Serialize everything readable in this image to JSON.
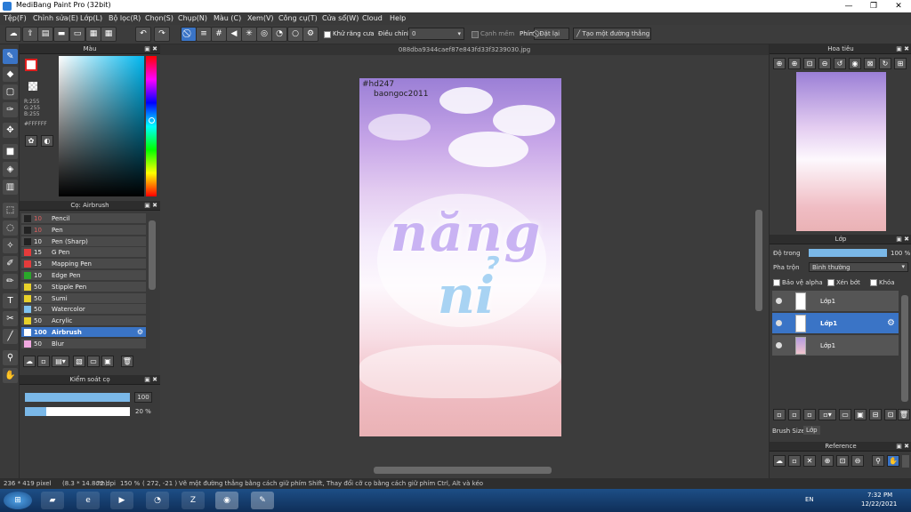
{
  "window": {
    "title": "MediBang Paint Pro (32bit)"
  },
  "menu": [
    "Tệp(F)",
    "Chỉnh sửa(E)",
    "Lớp(L)",
    "Bộ lọc(R)",
    "Chọn(S)",
    "Chụp(N)",
    "Màu (C)",
    "Xem(V)",
    "Công cụ(T)",
    "Cửa sổ(W)",
    "Cloud",
    "Help"
  ],
  "toolbar": {
    "antialias_label": "Khử răng cưa",
    "adjust_label": "Điều chỉnh",
    "adjust_value": "0",
    "edge_label": "Cạnh mềm",
    "key_label": "Phím",
    "reset_label": "Đặt lại",
    "straight_line_label": "Tạo một đường thẳng"
  },
  "color_panel": {
    "title": "Màu",
    "r": "R:255",
    "g": "G:255",
    "b": "B:255",
    "hex": "#FFFFFF"
  },
  "brush_panel": {
    "title": "Cọ: Airbrush",
    "brushes": [
      {
        "size": "10",
        "name": "Pencil",
        "color": "#222222"
      },
      {
        "size": "10",
        "name": "Pen",
        "color": "#222222"
      },
      {
        "size": "10",
        "name": "Pen (Sharp)",
        "color": "#222222"
      },
      {
        "size": "15",
        "name": "G Pen",
        "color": "#e53b3b"
      },
      {
        "size": "15",
        "name": "Mapping Pen",
        "color": "#e53b3b"
      },
      {
        "size": "10",
        "name": "Edge Pen",
        "color": "#2aa82a"
      },
      {
        "size": "50",
        "name": "Stipple Pen",
        "color": "#e8d12a"
      },
      {
        "size": "50",
        "name": "Sumi",
        "color": "#e8d12a"
      },
      {
        "size": "50",
        "name": "Watercolor",
        "color": "#7fc3f0"
      },
      {
        "size": "50",
        "name": "Acrylic",
        "color": "#e8d12a"
      },
      {
        "size": "100",
        "name": "Airbrush",
        "color": "#ffffff"
      },
      {
        "size": "50",
        "name": "Blur",
        "color": "#f0a8e0"
      }
    ]
  },
  "brush_control": {
    "title": "Kiểm soát cọ",
    "size_value": "100",
    "size_fraction": 1.0,
    "opacity_value": "20 %",
    "opacity_fraction": 0.2
  },
  "document": {
    "tab": "088dba9344caef87e843fd33f3239030.jpg",
    "watermark1": "#hd247",
    "watermark2": "baongoc2011",
    "art_text_line1": "năng",
    "art_text_line2": "nỉ"
  },
  "navigator": {
    "title": "Hoa tiêu"
  },
  "layer_panel": {
    "title": "Lớp",
    "opacity_label": "Độ trong",
    "opacity_value": "100 %",
    "opacity_fraction": 1.0,
    "blend_label": "Pha trộn",
    "blend_value": "Bình thường",
    "alpha_label": "Bảo vệ alpha",
    "clip_label": "Xén bớt",
    "lock_label": "Khóa",
    "layers": [
      {
        "name": "Lớp1",
        "selected": false
      },
      {
        "name": "Lớp1",
        "selected": true
      },
      {
        "name": "Lớp1",
        "selected": false
      }
    ],
    "tab_brush_size": "Brush Size",
    "tab_layer": "Lớp"
  },
  "reference": {
    "title": "Reference"
  },
  "status": {
    "size": "236 * 419 pixel",
    "size_cm": "(8.3 * 14.8cm)",
    "dpi": "72 dpi",
    "zoom": "150 %",
    "coords": "( 272, -21 )",
    "hint": "Vẽ một đường thẳng bằng cách giữ phím Shift, Thay đổi cỡ cọ bằng cách giữ phím Ctrl, Alt và kéo"
  },
  "taskbar": {
    "lang": "EN",
    "time": "7:32 PM",
    "date": "12/22/2021"
  },
  "colors": {
    "accent": "#3a74c6",
    "panel": "#3a3a3a"
  }
}
